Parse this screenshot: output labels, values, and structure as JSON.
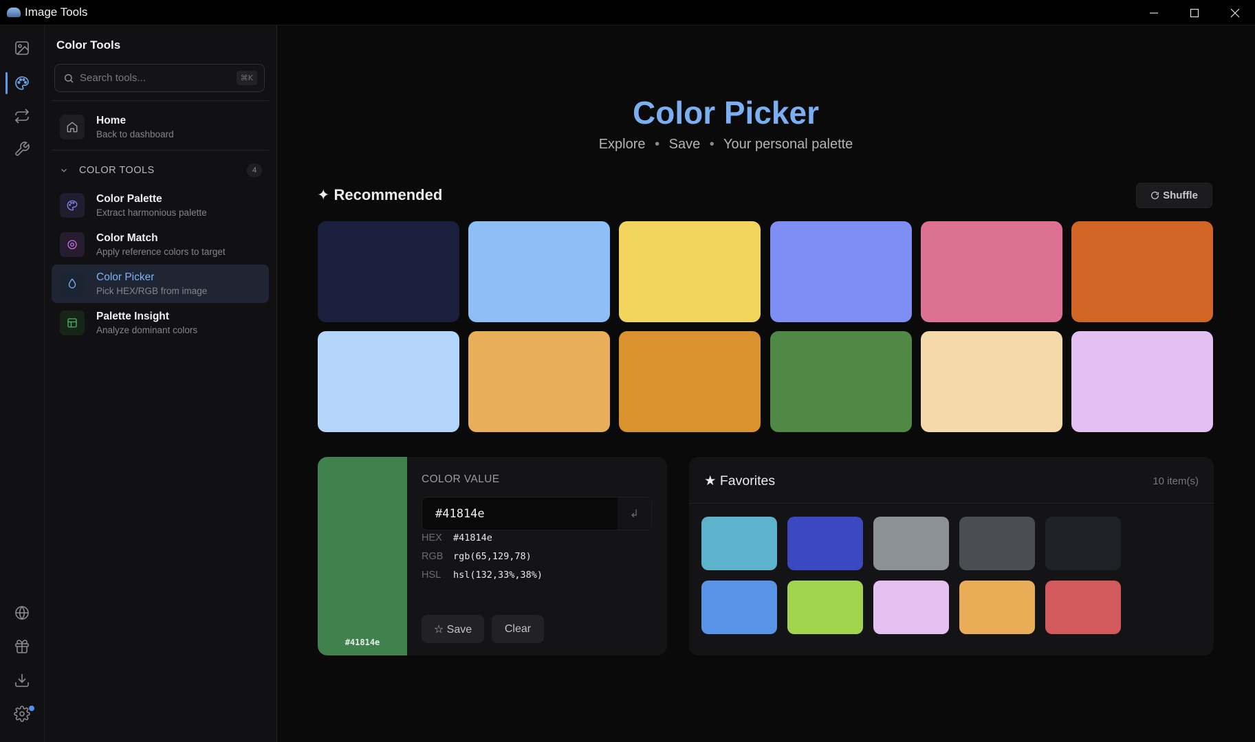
{
  "window": {
    "title": "Image Tools"
  },
  "rail": {
    "icons": [
      "image-icon",
      "palette-icon",
      "convert-icon",
      "tools-icon",
      "globe-icon",
      "gift-icon",
      "download-icon",
      "settings-icon"
    ]
  },
  "sidebar": {
    "title": "Color Tools",
    "search": {
      "placeholder": "Search tools...",
      "shortcut": "⌘K"
    },
    "home": {
      "label": "Home",
      "sub": "Back to dashboard"
    },
    "section": {
      "label": "COLOR TOOLS",
      "count": "4"
    },
    "items": [
      {
        "label": "Color Palette",
        "sub": "Extract harmonious palette",
        "icon": "palette-icon",
        "accent": "#8b7ff0"
      },
      {
        "label": "Color Match",
        "sub": "Apply reference colors to target",
        "icon": "target-icon",
        "accent": "#c26ee0"
      },
      {
        "label": "Color Picker",
        "sub": "Pick HEX/RGB from image",
        "icon": "droplet-icon",
        "accent": "#7ab0f2"
      },
      {
        "label": "Palette Insight",
        "sub": "Analyze dominant colors",
        "icon": "grid-icon",
        "accent": "#4caf6a"
      }
    ]
  },
  "main": {
    "title": "Color Picker",
    "subtitle": [
      "Explore",
      "Save",
      "Your personal palette"
    ],
    "subtitle_sep": "•",
    "recommended": {
      "title": "✦ Recommended",
      "shuffle_label": "Shuffle",
      "colors": [
        "#1b1f3e",
        "#8fbdf6",
        "#f3d55e",
        "#7f8ef3",
        "#dc7193",
        "#d06526",
        "#b3d5fb",
        "#e9ae5a",
        "#da922e",
        "#4f8945",
        "#f5d9ab",
        "#e3c0f2"
      ]
    },
    "color_value": {
      "heading": "COLOR VALUE",
      "preview_color": "#41814e",
      "preview_label": "#41814e",
      "input_value": "#41814e",
      "enter_symbol": "↲",
      "hex_label": "HEX",
      "hex": "#41814e",
      "rgb_label": "RGB",
      "rgb": "rgb(65,129,78)",
      "hsl_label": "HSL",
      "hsl": "hsl(132,33%,38%)",
      "save_label": "☆ Save",
      "clear_label": "Clear"
    },
    "favorites": {
      "title": "★ Favorites",
      "count": "10 item(s)",
      "colors": [
        "#5db3cb",
        "#3b48c2",
        "#8c9196",
        "#4a4d52",
        "#1e2125",
        "#5a94e8",
        "#a3d44e",
        "#e5c1f1",
        "#e9ad57",
        "#d25a5d"
      ]
    }
  }
}
